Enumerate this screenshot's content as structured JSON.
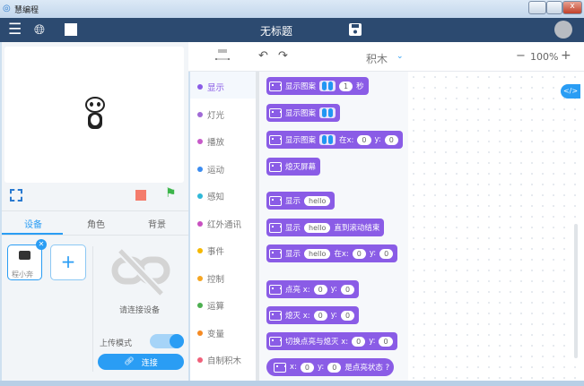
{
  "window": {
    "title": "慧编程"
  },
  "header": {
    "project_title": "无标题"
  },
  "toolbar": {
    "mode": "积木",
    "zoom": "100%"
  },
  "stage_tabs": [
    "设备",
    "角色",
    "背景"
  ],
  "device": {
    "name": "程小奔",
    "connect_hint": "请连接设备",
    "upload_mode": "上传模式",
    "upload_mode_on": true,
    "connect": "连接"
  },
  "categories": [
    {
      "label": "显示",
      "color": "#8a5ce6"
    },
    {
      "label": "灯光",
      "color": "#a06ad6"
    },
    {
      "label": "播放",
      "color": "#c75ac9"
    },
    {
      "label": "运动",
      "color": "#3b8cf0"
    },
    {
      "label": "感知",
      "color": "#2fb8d8"
    },
    {
      "label": "红外通讯",
      "color": "#c850c0"
    },
    {
      "label": "事件",
      "color": "#f5b800"
    },
    {
      "label": "控制",
      "color": "#f5a623"
    },
    {
      "label": "运算",
      "color": "#4caf50"
    },
    {
      "label": "变量",
      "color": "#f58a23"
    },
    {
      "label": "自制积木",
      "color": "#f0607a"
    }
  ],
  "blocks": {
    "show_image": "显示图案",
    "secs_val": "1",
    "secs": "秒",
    "at_x": "在x:",
    "y": "y:",
    "zero": "0",
    "clear": "熄灭屏幕",
    "show": "显示",
    "hello": "hello",
    "until_done": "直到滚动结束",
    "light": "点亮 x:",
    "off": "熄灭 x:",
    "toggle": "切换点亮与熄灭 x:",
    "x": "x:",
    "is_lit": "是点亮状态 ?"
  }
}
